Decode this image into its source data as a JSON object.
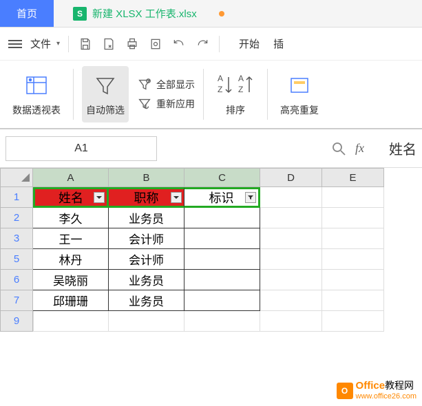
{
  "tabs": {
    "home": "首页",
    "file_icon": "S",
    "file_name": "新建 XLSX 工作表.xlsx"
  },
  "toolbar": {
    "file_menu": "文件",
    "start": "开始",
    "insert": "插"
  },
  "ribbon": {
    "pivot": "数据透视表",
    "autofilter": "自动筛选",
    "show_all": "全部显示",
    "reapply": "重新应用",
    "sort": "排序",
    "highlight": "高亮重复"
  },
  "fxbar": {
    "name": "A1",
    "fx": "fx",
    "value": "姓名"
  },
  "columns": [
    "A",
    "B",
    "C",
    "D",
    "E"
  ],
  "headers": {
    "c1": "姓名",
    "c2": "职称",
    "c3": "标识"
  },
  "rows": [
    {
      "n": "1"
    },
    {
      "n": "2",
      "c1": "李久",
      "c2": "业务员",
      "c3": ""
    },
    {
      "n": "3",
      "c1": "王一",
      "c2": "会计师",
      "c3": ""
    },
    {
      "n": "5",
      "c1": "林丹",
      "c2": "会计师",
      "c3": ""
    },
    {
      "n": "6",
      "c1": "吴晓丽",
      "c2": "业务员",
      "c3": ""
    },
    {
      "n": "7",
      "c1": "邱珊珊",
      "c2": "业务员",
      "c3": ""
    },
    {
      "n": "9"
    }
  ],
  "watermark": {
    "brand": "Office",
    "suffix": "教程网",
    "url": "www.office26.com"
  }
}
